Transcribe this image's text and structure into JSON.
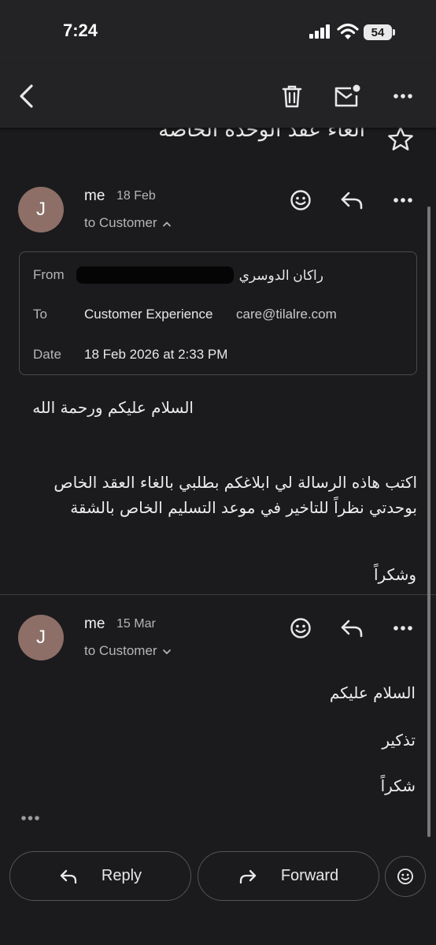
{
  "status_bar": {
    "time": "7:24",
    "battery": "54",
    "icons": [
      "signal-icon",
      "wifi-icon",
      "battery-icon"
    ]
  },
  "toolbar": {
    "icons": [
      "back-arrow-icon",
      "trash-icon",
      "mark-unread-icon",
      "more-vert-icon"
    ]
  },
  "subject": "الغاء عقد الوحدة الخاصة",
  "messages": [
    {
      "avatar_initial": "J",
      "sender": "me",
      "date": "18 Feb",
      "to_line": "to Customer",
      "details": {
        "from_label": "From",
        "from_value": "راكان الدوسري",
        "to_label": "To",
        "to_name": "Customer Experience",
        "to_email": "care@tilalre.com",
        "date_label": "Date",
        "date_value": "18 Feb 2026 at 2:33 PM"
      },
      "body": [
        "السلام عليكم ورحمة الله",
        "اكتب هاذه الرسالة لي ابلاغكم بطلبي بالغاء العقد الخاص بوحدتي نظراً للتاخير في موعد التسليم الخاص بالشقة",
        "وشكراً"
      ]
    },
    {
      "avatar_initial": "J",
      "sender": "me",
      "date": "15 Mar",
      "to_line": "to Customer",
      "body": [
        "السلام عليكم",
        "تذكير",
        "شكراً"
      ]
    }
  ],
  "actions": {
    "reply": "Reply",
    "forward": "Forward"
  },
  "colors": {
    "background": "#1b1b1d",
    "appbar": "#232325",
    "avatar": "#8d6f68",
    "text_secondary": "#b5b5b8",
    "border": "#4a4a4e"
  }
}
